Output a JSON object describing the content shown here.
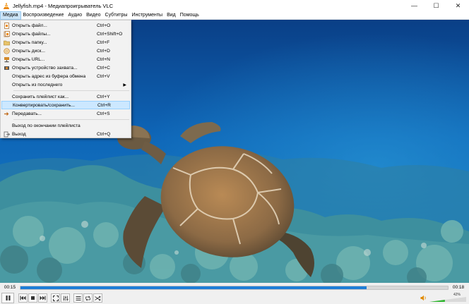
{
  "window": {
    "title": "Jellyfish.mp4 - Медиапроигрыватель VLC",
    "controls": {
      "minimize": "—",
      "maximize": "☐",
      "close": "✕"
    }
  },
  "menubar": [
    "Медиа",
    "Воспроизведение",
    "Аудио",
    "Видео",
    "Субтитры",
    "Инструменты",
    "Вид",
    "Помощь"
  ],
  "media_menu": {
    "items": [
      {
        "label": "Открыть файл...",
        "shortcut": "Ctrl+O",
        "icon": "file-icon"
      },
      {
        "label": "Открыть файлы...",
        "shortcut": "Ctrl+Shift+O",
        "icon": "files-icon"
      },
      {
        "label": "Открыть папку...",
        "shortcut": "Ctrl+F",
        "icon": "folder-icon"
      },
      {
        "label": "Открыть диск...",
        "shortcut": "Ctrl+D",
        "icon": "disc-icon"
      },
      {
        "label": "Открыть URL...",
        "shortcut": "Ctrl+N",
        "icon": "network-icon"
      },
      {
        "label": "Открыть устройство захвата...",
        "shortcut": "Ctrl+C",
        "icon": "capture-icon"
      },
      {
        "label": "Открыть адрес из буфера обмена",
        "shortcut": "Ctrl+V",
        "icon": ""
      },
      {
        "label": "Открыть из последнего",
        "shortcut": "",
        "icon": "",
        "submenu": "▶"
      },
      {
        "label": "Сохранить плейлист как...",
        "shortcut": "Ctrl+Y",
        "icon": ""
      },
      {
        "label": "Конвертировать/сохранить...",
        "shortcut": "Ctrl+R",
        "icon": "",
        "highlighted": true
      },
      {
        "label": "Передавать...",
        "shortcut": "Ctrl+S",
        "icon": "stream-icon"
      },
      {
        "label": "Выход по окончании плейлиста",
        "shortcut": "",
        "icon": ""
      },
      {
        "label": "Выход",
        "shortcut": "Ctrl+Q",
        "icon": "exit-icon"
      }
    ]
  },
  "player": {
    "time_elapsed": "00:15",
    "time_total": "00:18",
    "progress": 0.81,
    "volume_label": "42%",
    "volume_level": 0.42
  },
  "colors": {
    "accent": "#1e7ed8",
    "menu_highlight": "#cce8ff",
    "volume_green": "#2fb52f"
  }
}
